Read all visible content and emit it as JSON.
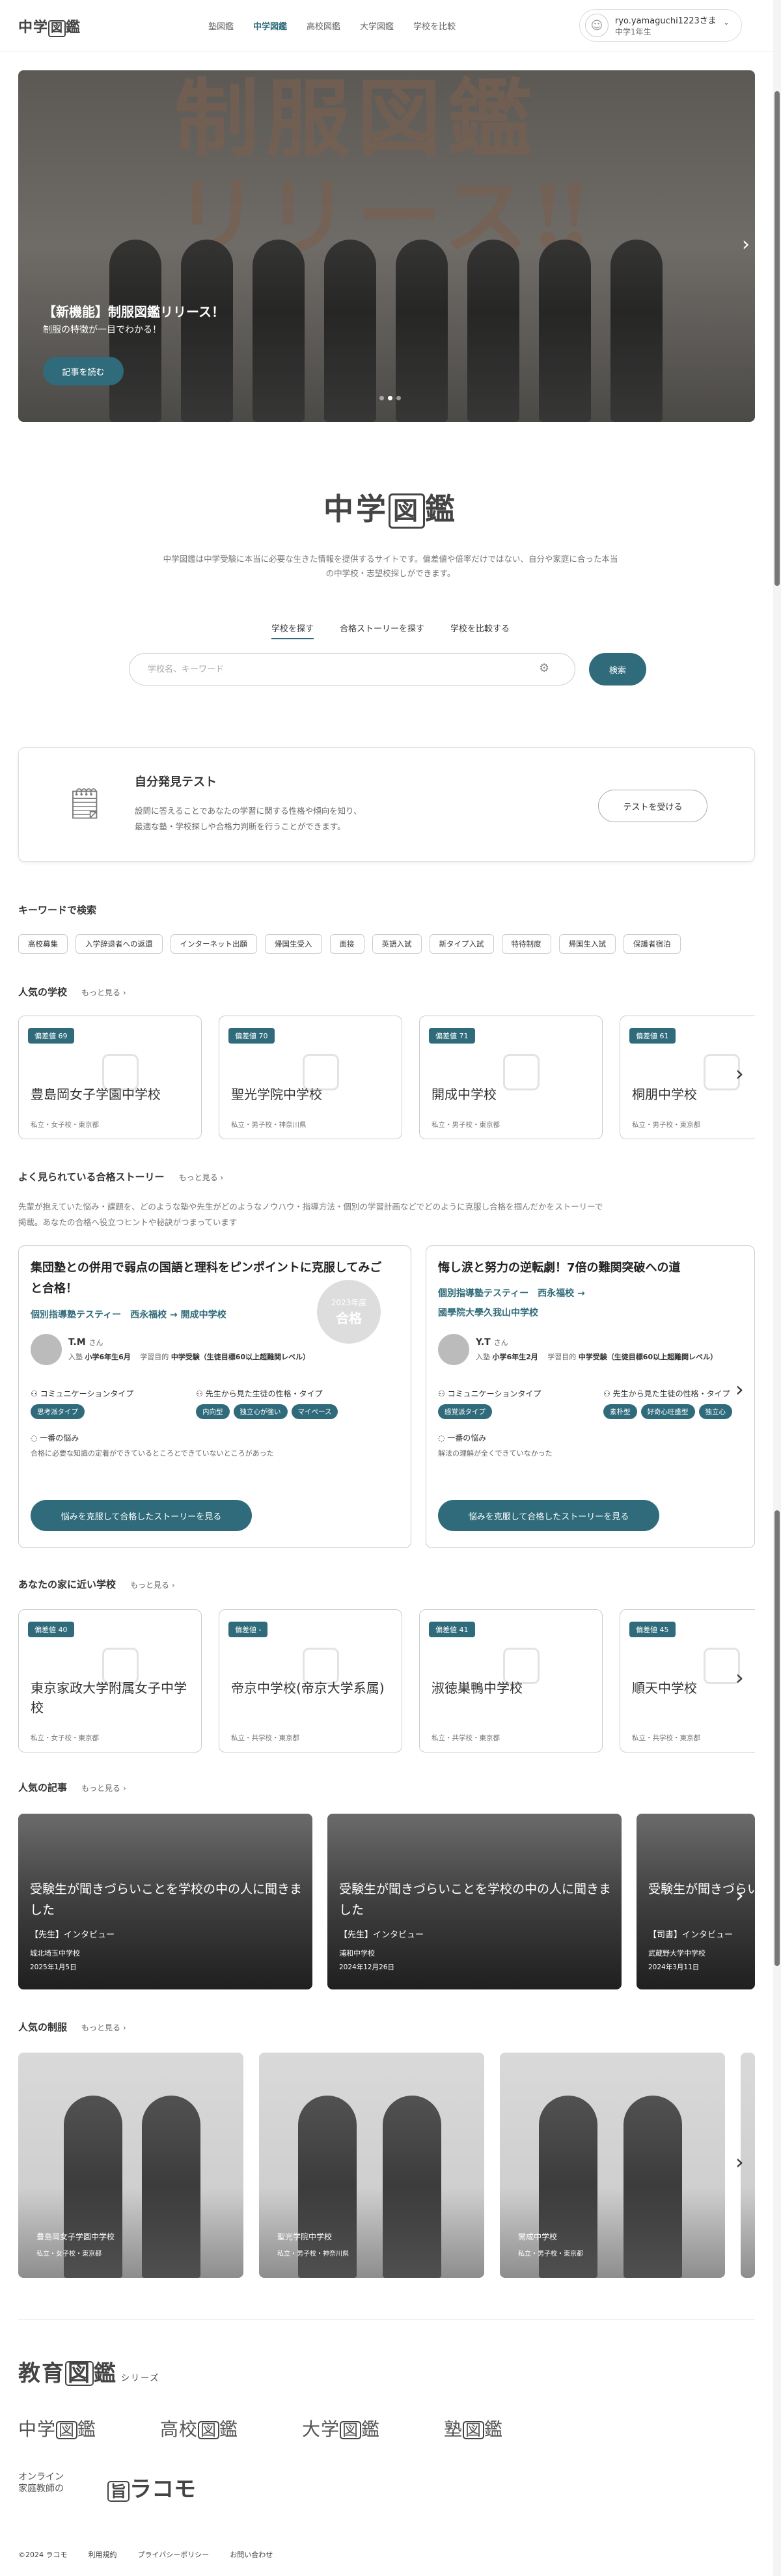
{
  "header": {
    "logo": "中学",
    "logo_box": "図",
    "logo_tail": "鑑",
    "nav": [
      "塾図鑑",
      "中学図鑑",
      "高校図鑑",
      "大学図鑑",
      "学校を比較"
    ],
    "active_nav": "中学図鑑",
    "user_name": "ryo.yamaguchi1223さま",
    "user_grade": "中学1年生"
  },
  "hero": {
    "big_text_line1": "制服図鑑",
    "big_text_line2": "リリース‼",
    "title": "【新機能】制服図鑑リリース！",
    "subtitle": "制服の特徴が一目でわかる！",
    "button": "記事を読む"
  },
  "brand": {
    "name_a": "中学",
    "name_box": "図",
    "name_b": "鑑",
    "desc_line1": "中学図鑑は中学受験に本当に必要な生きた情報を提供するサイトです。偏差値や倍率だけではない、自分や家庭に合った本当",
    "desc_line2": "の中学校・志望校探しができます。"
  },
  "search_tabs": [
    "学校を探す",
    "合格ストーリーを探す",
    "学校を比較する"
  ],
  "search": {
    "placeholder": "学校名、キーワード",
    "button": "検索"
  },
  "test": {
    "title": "自分発見テスト",
    "desc_line1": "設問に答えることであなたの学習に関する性格や傾向を知り、",
    "desc_line2": "最適な塾・学校探しや合格力判断を行うことができます。",
    "button": "テストを受ける"
  },
  "keywords": {
    "title": "キーワードで検索",
    "items": [
      "高校募集",
      "入学辞退者への返還",
      "インターネット出願",
      "帰国生受入",
      "面接",
      "英語入試",
      "新タイプ入試",
      "特待制度",
      "帰国生入試",
      "保護者宿泊"
    ]
  },
  "popular": {
    "title": "人気の学校",
    "more": "もっと見る ›",
    "schools": [
      {
        "hensachi": "偏差値 69",
        "name": "豊島岡女子学園中学校",
        "meta": "私立・女子校・東京都"
      },
      {
        "hensachi": "偏差値 70",
        "name": "聖光学院中学校",
        "meta": "私立・男子校・神奈川県"
      },
      {
        "hensachi": "偏差値 71",
        "name": "開成中学校",
        "meta": "私立・男子校・東京都"
      },
      {
        "hensachi": "偏差値 61",
        "name": "桐朋中学校",
        "meta": "私立・男子校・東京都"
      }
    ]
  },
  "stories": {
    "title": "よく見られている合格ストーリー",
    "more": "もっと見る ›",
    "intro_line1": "先輩が抱えていた悩み・課題を、どのような塾や先生がどのようなノウハウ・指導方法・個別の学習計画などでどのように克服し合格を掴んだかをストーリーで",
    "intro_line2": "掲載。あなたの合格へ役立つヒントや秘訣がつまっています",
    "items": [
      {
        "title": "集団塾との併用で弱点の国語と理科をピンポイントに克服してみごと合格！",
        "juku": "個別指導塾テスティー　西永福校",
        "school": "開成中学校",
        "stamp_top": "2023年度",
        "stamp_main": "合格",
        "user": "T.M",
        "san": "さん",
        "join_label": "入塾",
        "join": "小学6年生6月",
        "goal_label": "学習目的",
        "goal": "中学受験（生徒目標60以上超難関レベル）",
        "comm_h": "コミュニケーションタイプ",
        "comm_tag": "思考派タイプ",
        "pref_h": "先生から見た生徒の性格・タイプ",
        "pref_tags": [
          "内向型",
          "独立心が強い",
          "マイペース"
        ],
        "worry_h": "一番の悩み",
        "worry": "合格に必要な知識の定着ができているところとできていないところがあった",
        "button": "悩みを克服して合格したストーリーを見る"
      },
      {
        "title": "悔し涙と努力の逆転劇！7倍の難関突破への道",
        "juku": "個別指導塾テスティー　西永福校",
        "school": "國學院大學久我山中学校",
        "user": "Y.T",
        "san": "さん",
        "join_label": "入塾",
        "join": "小学6年生2月",
        "goal_label": "学習目的",
        "goal": "中学受験（生徒目標60以上超難関レベル）",
        "comm_h": "コミュニケーションタイプ",
        "comm_tag": "感覚派タイプ",
        "pref_h": "先生から見た生徒の性格・タイプ",
        "pref_tags": [
          "素朴型",
          "好奇心旺盛型",
          "独立心"
        ],
        "worry_h": "一番の悩み",
        "worry": "解法の理解が全くできていなかった",
        "button": "悩みを克服して合格したストーリーを見る"
      }
    ]
  },
  "nearby": {
    "title": "あなたの家に近い学校",
    "more": "もっと見る ›",
    "schools": [
      {
        "hensachi": "偏差値 40",
        "name": "東京家政大学附属女子中学校",
        "meta": "私立・女子校・東京都"
      },
      {
        "hensachi": "偏差値 -",
        "name": "帝京中学校(帝京大学系属)",
        "meta": "私立・共学校・東京都"
      },
      {
        "hensachi": "偏差値 41",
        "name": "淑徳巣鴨中学校",
        "meta": "私立・共学校・東京都"
      },
      {
        "hensachi": "偏差値 45",
        "name": "順天中学校",
        "meta": "私立・共学校・東京都"
      }
    ]
  },
  "articles": {
    "title": "人気の記事",
    "more": "もっと見る ›",
    "items": [
      {
        "title": "受験生が聞きづらいことを学校の中の人に聞きました",
        "type": "【先生】インタビュー",
        "school": "城北埼玉中学校",
        "date": "2025年1月5日"
      },
      {
        "title": "受験生が聞きづらいことを学校の中の人に聞きました",
        "type": "【先生】インタビュー",
        "school": "浦和中学校",
        "date": "2024年12月26日"
      },
      {
        "title": "受験生が聞きづらいことを学校の中の人に聞きました",
        "type": "【司書】インタビュー",
        "school": "武蔵野大学中学校",
        "date": "2024年3月11日"
      }
    ]
  },
  "uniforms": {
    "title": "人気の制服",
    "more": "もっと見る ›",
    "items": [
      {
        "name": "豊島岡女子学園中学校",
        "meta": "私立・女子校・東京都"
      },
      {
        "name": "聖光学院中学校",
        "meta": "私立・男子校・神奈川県"
      },
      {
        "name": "開成中学校",
        "meta": "私立・男子校・東京都"
      }
    ]
  },
  "footer": {
    "series_a": "教育",
    "series_box": "図",
    "series_b": "鑑",
    "series_suffix": "シリーズ",
    "sublogos": [
      "中学",
      "高校",
      "大学",
      "塾"
    ],
    "sub_box": "図",
    "sub_tail": "鑑",
    "rakomo_line1": "オンライン",
    "rakomo_line2": "家庭教師の",
    "rakomo_box": "旨",
    "rakomo": "ラコモ",
    "links": [
      "©2024 ラコモ",
      "利用規約",
      "プライバシーポリシー",
      "お問い合わせ"
    ]
  }
}
